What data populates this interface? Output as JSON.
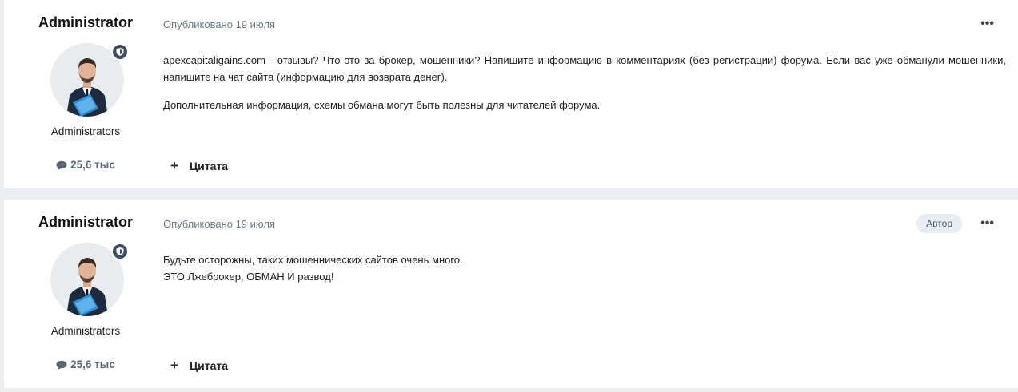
{
  "posts": [
    {
      "author": "Administrator",
      "group": "Administrators",
      "post_count": "25,6 тыс",
      "date": "Опубликовано 19 июля",
      "author_badge": "",
      "menu": "•••",
      "paragraphs": [
        "apexcapitaligains.com - отзывы? Что это за брокер, мошенники? Напишите информацию в комментариях (без регистрации) форума. Если вас уже обманули мошенники, напишите на чат сайта (информацию для возврата денег).",
        "Дополнительная информация, схемы обмана могут быть полезны для читателей форума."
      ],
      "quote_label": "Цитата",
      "quote_icon": "+"
    },
    {
      "author": "Administrator",
      "group": "Administrators",
      "post_count": "25,6 тыс",
      "date": "Опубликовано 19 июля",
      "author_badge": "Автор",
      "menu": "•••",
      "paragraphs": [
        "Будьте осторожны, таких мошеннических сайтов очень много.",
        "ЭТО Лжеброкер, ОБМАН И развод!"
      ],
      "quote_label": "Цитата",
      "quote_icon": "+"
    }
  ],
  "icons": {
    "badge": "shield-icon",
    "comment": "comment-bubble-icon",
    "menu": "ellipsis-icon",
    "quote": "plus-icon"
  },
  "colors": {
    "background": "#ebeef2",
    "card": "#ffffff",
    "badge": "#3e4f65",
    "muted": "#6b7884"
  }
}
